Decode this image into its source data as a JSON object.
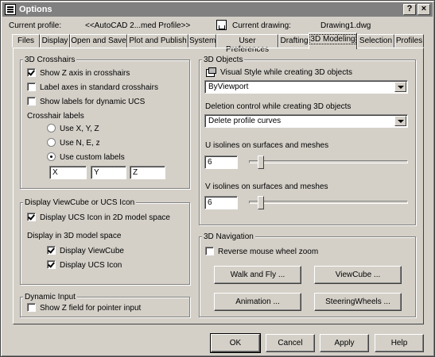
{
  "window": {
    "title": "Options",
    "help_glyph": "?",
    "close_glyph": "×"
  },
  "header": {
    "profile_label": "Current profile:",
    "profile_value": "<<AutoCAD 2...med Profile>>",
    "drawing_label": "Current drawing:",
    "drawing_value": "Drawing1.dwg"
  },
  "tabs": [
    {
      "label": "Files"
    },
    {
      "label": "Display"
    },
    {
      "label": "Open and Save"
    },
    {
      "label": "Plot and Publish"
    },
    {
      "label": "System"
    },
    {
      "label": "User Preferences"
    },
    {
      "label": "Drafting"
    },
    {
      "label": "3D Modeling",
      "active": true
    },
    {
      "label": "Selection"
    },
    {
      "label": "Profiles"
    }
  ],
  "crosshairs": {
    "title": "3D Crosshairs",
    "show_z_axis": {
      "label": "Show Z axis in crosshairs",
      "checked": true
    },
    "label_axes": {
      "label": "Label axes in standard crosshairs",
      "checked": false
    },
    "show_labels_ucs": {
      "label": "Show labels for dynamic UCS",
      "checked": false
    },
    "crosshair_labels_title": "Crosshair labels",
    "radio_xyz": {
      "label": "Use X, Y, Z",
      "checked": false
    },
    "radio_nez": {
      "label": "Use N, E, z",
      "checked": false
    },
    "radio_custom": {
      "label": "Use custom labels",
      "checked": true
    },
    "custom_x": "X",
    "custom_y": "Y",
    "custom_z": "Z"
  },
  "viewcube": {
    "title": "Display ViewCube or UCS Icon",
    "ucs_icon_2d": {
      "label": "Display UCS Icon in 2D model space",
      "checked": true
    },
    "model_space_title": "Display in 3D model space",
    "display_viewcube": {
      "label": "Display ViewCube",
      "checked": true
    },
    "display_ucs_icon": {
      "label": "Display UCS Icon",
      "checked": true
    }
  },
  "dynamic_input": {
    "title": "Dynamic Input",
    "show_z_field": {
      "label": "Show Z field for pointer input",
      "checked": false
    }
  },
  "objects": {
    "title": "3D Objects",
    "visual_style_label": "Visual Style while creating 3D objects",
    "visual_style_value": "ByViewport",
    "deletion_label": "Deletion control while creating 3D objects",
    "deletion_value": "Delete profile curves",
    "u_isolines_label": "U isolines on surfaces and meshes",
    "u_isolines_value": "6",
    "v_isolines_label": "V isolines on surfaces and meshes",
    "v_isolines_value": "6"
  },
  "navigation": {
    "title": "3D Navigation",
    "reverse_wheel": {
      "label": "Reverse mouse wheel zoom",
      "checked": false
    },
    "walk_fly_label": "Walk and Fly ...",
    "viewcube_label": "ViewCube ...",
    "animation_label": "Animation ...",
    "steeringwheels_label": "SteeringWheels ..."
  },
  "footer": {
    "ok_label": "OK",
    "cancel_label": "Cancel",
    "apply_label": "Apply",
    "help_label": "Help"
  }
}
